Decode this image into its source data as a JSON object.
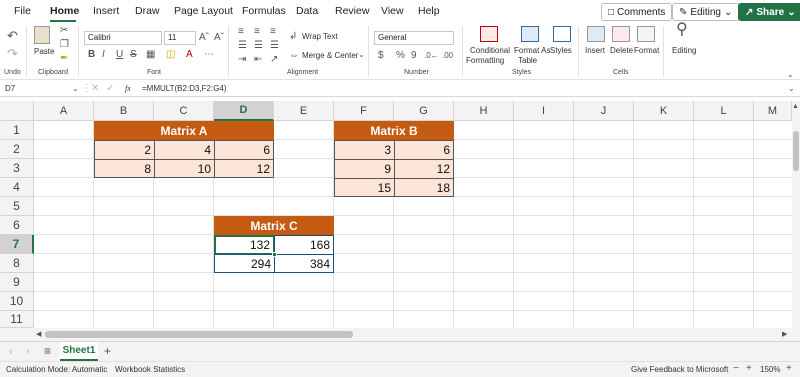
{
  "menu": {
    "tabs": [
      "File",
      "Home",
      "Insert",
      "Draw",
      "Page Layout",
      "Formulas",
      "Data",
      "Review",
      "View",
      "Help"
    ],
    "comments": "Comments",
    "editing": "Editing",
    "share": "Share"
  },
  "ribbon": {
    "undo": "Undo",
    "paste": "Paste",
    "clipboard": "Clipboard",
    "font_name": "Calibri",
    "font_size": "11",
    "font": "Font",
    "wrap_text": "Wrap Text",
    "merge_center": "Merge & Center",
    "alignment": "Alignment",
    "number_format": "General",
    "number": "Number",
    "conditional_1": "Conditional",
    "conditional_2": "Formatting",
    "format_as_1": "Format As",
    "format_as_2": "Table",
    "styles_btn": "Styles",
    "styles": "Styles",
    "insert": "Insert",
    "delete": "Delete",
    "format": "Format",
    "cells": "Cells",
    "editing": "Editing"
  },
  "formula_bar": {
    "name_box": "D7",
    "fx": "fx",
    "formula": "=MMULT(B2:D3,F2:G4)"
  },
  "grid": {
    "columns": [
      "A",
      "B",
      "C",
      "D",
      "E",
      "F",
      "G",
      "H",
      "I",
      "J",
      "K",
      "L",
      "M"
    ],
    "rows": [
      "1",
      "2",
      "3",
      "4",
      "5",
      "6",
      "7",
      "8",
      "9",
      "10",
      "11"
    ]
  },
  "matrix_a": {
    "title": "Matrix A",
    "values": [
      [
        "2",
        "4",
        "6"
      ],
      [
        "8",
        "10",
        "12"
      ]
    ]
  },
  "matrix_b": {
    "title": "Matrix B",
    "values": [
      [
        "3",
        "6"
      ],
      [
        "9",
        "12"
      ],
      [
        "15",
        "18"
      ]
    ]
  },
  "matrix_c": {
    "title": "Matrix C",
    "values": [
      [
        "132",
        "168"
      ],
      [
        "294",
        "384"
      ]
    ]
  },
  "sheets": {
    "active": "Sheet1",
    "add": "+"
  },
  "status": {
    "calc_mode": "Calculation Mode: Automatic",
    "workbook_stats": "Workbook Statistics",
    "feedback": "Give Feedback to Microsoft",
    "zoom": "150%"
  }
}
